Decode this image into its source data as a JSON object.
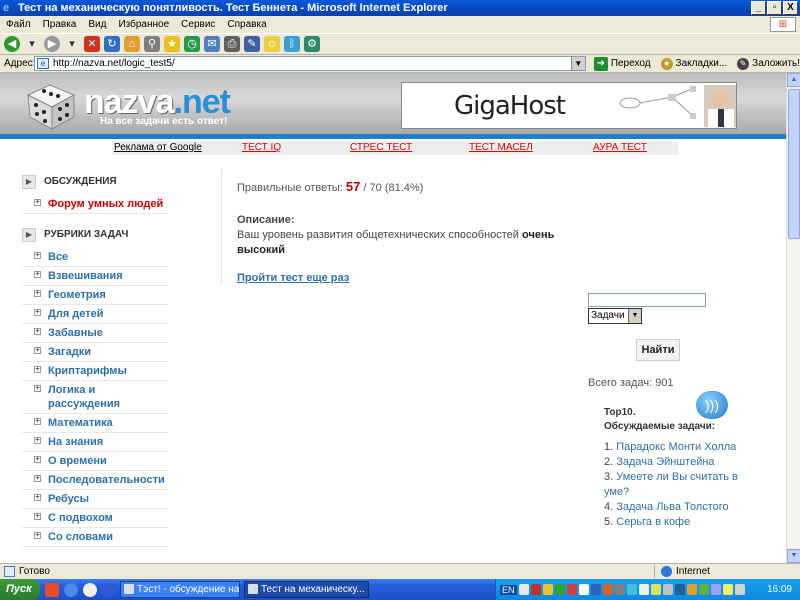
{
  "window": {
    "title": "Тест на механическую понятливость. Тест Беннета - Microsoft Internet Explorer",
    "controls": [
      "_",
      "▫",
      "X"
    ]
  },
  "menu": [
    "Файл",
    "Правка",
    "Вид",
    "Избранное",
    "Сервис",
    "Справка"
  ],
  "address": {
    "label": "Адрес:",
    "url": "http://nazva.net/logic_test5/",
    "go_label": "Переход",
    "links": [
      "Закладки...",
      "Заложить!"
    ]
  },
  "site": {
    "logo_name": "nazva",
    "logo_domain": ".net",
    "tagline": "На все задачи есть ответ!",
    "banner_name": "GigaHost",
    "nav": {
      "google": "Реклама от Google",
      "items": [
        "ТЕСТ IQ",
        "СТРЕС ТЕСТ",
        "ТЕСТ МАСЕЛ",
        "АУРА ТЕСТ"
      ]
    }
  },
  "sidebar": {
    "discuss_title": "ОБСУЖДЕНИЯ",
    "forum_item": "Форум умных людей",
    "rubrics_title": "РУБРИКИ ЗАДАЧ",
    "rubrics": [
      "Все",
      "Взвешивания",
      "Геометрия",
      "Для детей",
      "Забавные",
      "Загадки",
      "Криптарифмы",
      "Логика и рассуждения",
      "Математика",
      "На знания",
      "О времени",
      "Последовательности",
      "Ребусы",
      "С подвохом",
      "Со словами"
    ]
  },
  "main": {
    "score_label": "Правильные ответы:",
    "score": "57",
    "score_rest": "/ 70 (81.4%)",
    "desc_title": "Описание:",
    "desc_text": "Ваш уровень развития общетехнических способностей",
    "desc_bold": "очень высокий",
    "retry": "Пройти тест еще раз"
  },
  "right": {
    "search_value": "",
    "select_value": "Задачи",
    "find_button": "Найти",
    "total": "Всего задач: 901",
    "top_title": "Top10.",
    "top_subtitle": "Обсуждаемые задачи:",
    "top": [
      {
        "num": "1.",
        "text": "Парадокс Монти Холла"
      },
      {
        "num": "2.",
        "text": "Задача Эйнштейна"
      },
      {
        "num": "3.",
        "text": "Умеете ли Вы считать в уме?"
      },
      {
        "num": "4.",
        "text": "Задача Льва Толстого"
      },
      {
        "num": "5.",
        "text": "Серьга в кофе"
      }
    ]
  },
  "status": {
    "left": "Готово",
    "zone": "Internet"
  },
  "taskbar": {
    "start": "Пуск",
    "tasks": [
      "Тэст! - обсуждение на ...",
      "Тест на механическу..."
    ],
    "lang": "EN",
    "clock": "16:09"
  },
  "colors": {
    "titlebar": "#0a58d8",
    "accent_blue": "#1e80c8",
    "link": "#2f6fa8",
    "score_red": "#c00000"
  }
}
